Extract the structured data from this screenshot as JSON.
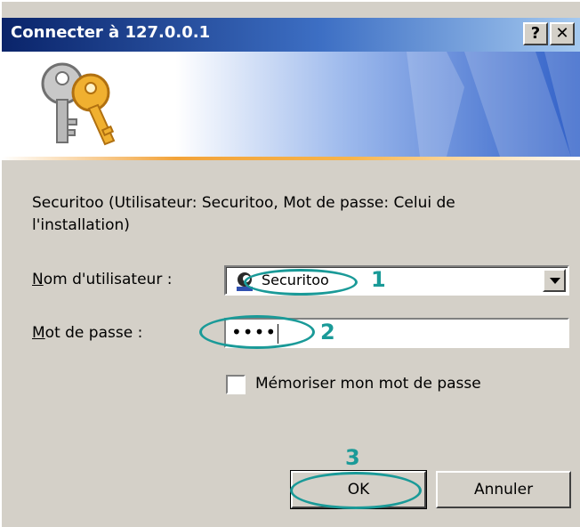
{
  "window": {
    "title": "Connecter à 127.0.0.1",
    "help_button": "?",
    "close_button": "✕"
  },
  "description": "Securitoo (Utilisateur: Securitoo, Mot de passe: Celui de l'installation)",
  "fields": {
    "username": {
      "label_first": "N",
      "label_rest": "om d'utilisateur :",
      "value": "Securitoo"
    },
    "password": {
      "label_first": "M",
      "label_rest": "ot de passe :",
      "value": "••••"
    },
    "remember": {
      "label": "Mémoriser mon mot de passe",
      "checked": false
    }
  },
  "buttons": {
    "ok": "OK",
    "cancel": "Annuler"
  },
  "annotations": {
    "marker_1": "1",
    "marker_2": "2",
    "marker_3": "3",
    "color": "#1a9a98"
  },
  "icons": {
    "keys": "keys-icon",
    "user": "user-icon"
  }
}
